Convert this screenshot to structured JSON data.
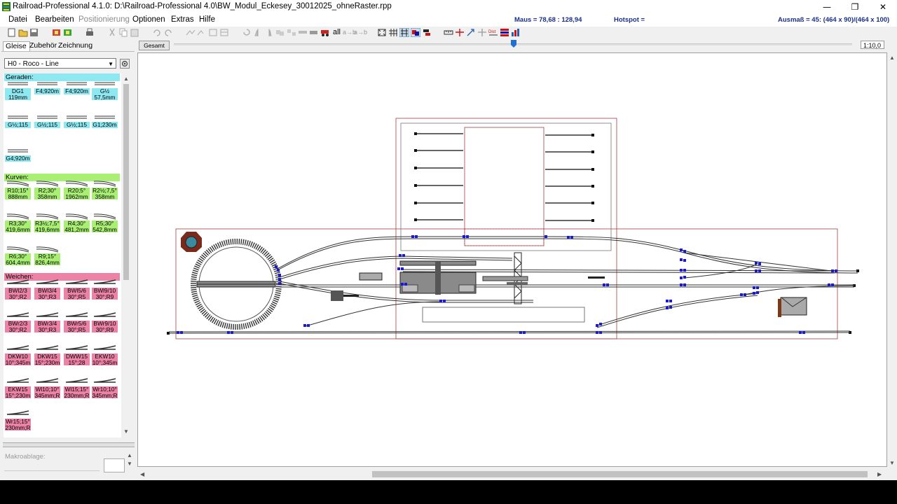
{
  "window": {
    "title": "Railroad-Professional 4.1.0:  D:\\Railroad-Professional 4.0\\BW_Modul_Eckesey_30012025_ohneRaster.rpp",
    "min_icon": "—",
    "restore_icon": "❐",
    "close_icon": "✕"
  },
  "menu": {
    "items": [
      "Datei",
      "Bearbeiten",
      "Positionierung",
      "Optionen",
      "Extras",
      "Hilfe"
    ],
    "disabled_index": 2
  },
  "status": {
    "mouse": "Maus = 78,68 : 128,94",
    "hotspot": "Hotspot =",
    "extent": "Ausmaß = 45: (464 x 90)/(464 x 100)"
  },
  "toolbar": {
    "all_label": "all",
    "text_labels": [
      "a→b",
      "a→b"
    ]
  },
  "tabs": [
    "Gleise",
    "Zubehör",
    "Zeichnung"
  ],
  "catalog": {
    "selected": "H0 - Roco - Line"
  },
  "palette": {
    "sections": [
      {
        "title": "Geraden:",
        "color": "#8ee8f2",
        "hdr": "#8ee8f2",
        "items": [
          [
            "DG1",
            "119mm"
          ],
          [
            "F4;920m",
            ""
          ],
          [
            "F4;920m",
            ""
          ],
          [
            "G½",
            "57,5mm"
          ],
          [
            "G½;115",
            ""
          ],
          [
            "G½;115",
            ""
          ],
          [
            "G½;115",
            ""
          ],
          [
            "G1;230m",
            ""
          ],
          [
            "G4;920m",
            ""
          ]
        ]
      },
      {
        "title": "Kurven:",
        "color": "#a8ef74",
        "hdr": "#a8ef74",
        "items": [
          [
            "R10;15°",
            "888mm"
          ],
          [
            "R2;30°",
            "358mm"
          ],
          [
            "R20;5°",
            "1962mm"
          ],
          [
            "R2½;7,5°",
            "358mm"
          ],
          [
            "R3;30°",
            "419,6mm"
          ],
          [
            "R3½;7,5°",
            "419,6mm"
          ],
          [
            "R4;30°",
            "481,2mm"
          ],
          [
            "R5;30°",
            "542,8mm"
          ],
          [
            "R6;30°",
            "604,4mm"
          ],
          [
            "R9;15°",
            "826,4mm"
          ]
        ]
      },
      {
        "title": "Weichen:",
        "color": "#ec82a6",
        "hdr": "#ec82a6",
        "items": [
          [
            "BWl2/3",
            "30°;R2"
          ],
          [
            "BWl3/4",
            "30°;R3"
          ],
          [
            "BWl5/6",
            "30°;R5"
          ],
          [
            "BWl9/10",
            "30°;R9"
          ],
          [
            "BWr2/3",
            "30°;R2"
          ],
          [
            "BWr3/4",
            "30°;R3"
          ],
          [
            "BWr5/6",
            "30°;R5"
          ],
          [
            "BWr9/10",
            "30°;R9"
          ],
          [
            "DKW10",
            "10°;345m"
          ],
          [
            "DKW15",
            "15°;230m"
          ],
          [
            "DWW15",
            "15°;28"
          ],
          [
            "EKW10",
            "10°;345m"
          ],
          [
            "EKW15",
            "15°;230m"
          ],
          [
            "Wl10;10°",
            "345mm;R"
          ],
          [
            "Wl15;15°",
            "230mm;R"
          ],
          [
            "Wr10;10°",
            "345mm;R"
          ],
          [
            "Wr15;15°",
            "230mm;R"
          ]
        ]
      }
    ]
  },
  "macro": {
    "label": "Makroablage:"
  },
  "zoom": {
    "overview_label": "Gesamt",
    "level": "1:10,0"
  },
  "colors": {
    "accent": "#1a2f8c",
    "track_end": "#1a1ad0"
  }
}
